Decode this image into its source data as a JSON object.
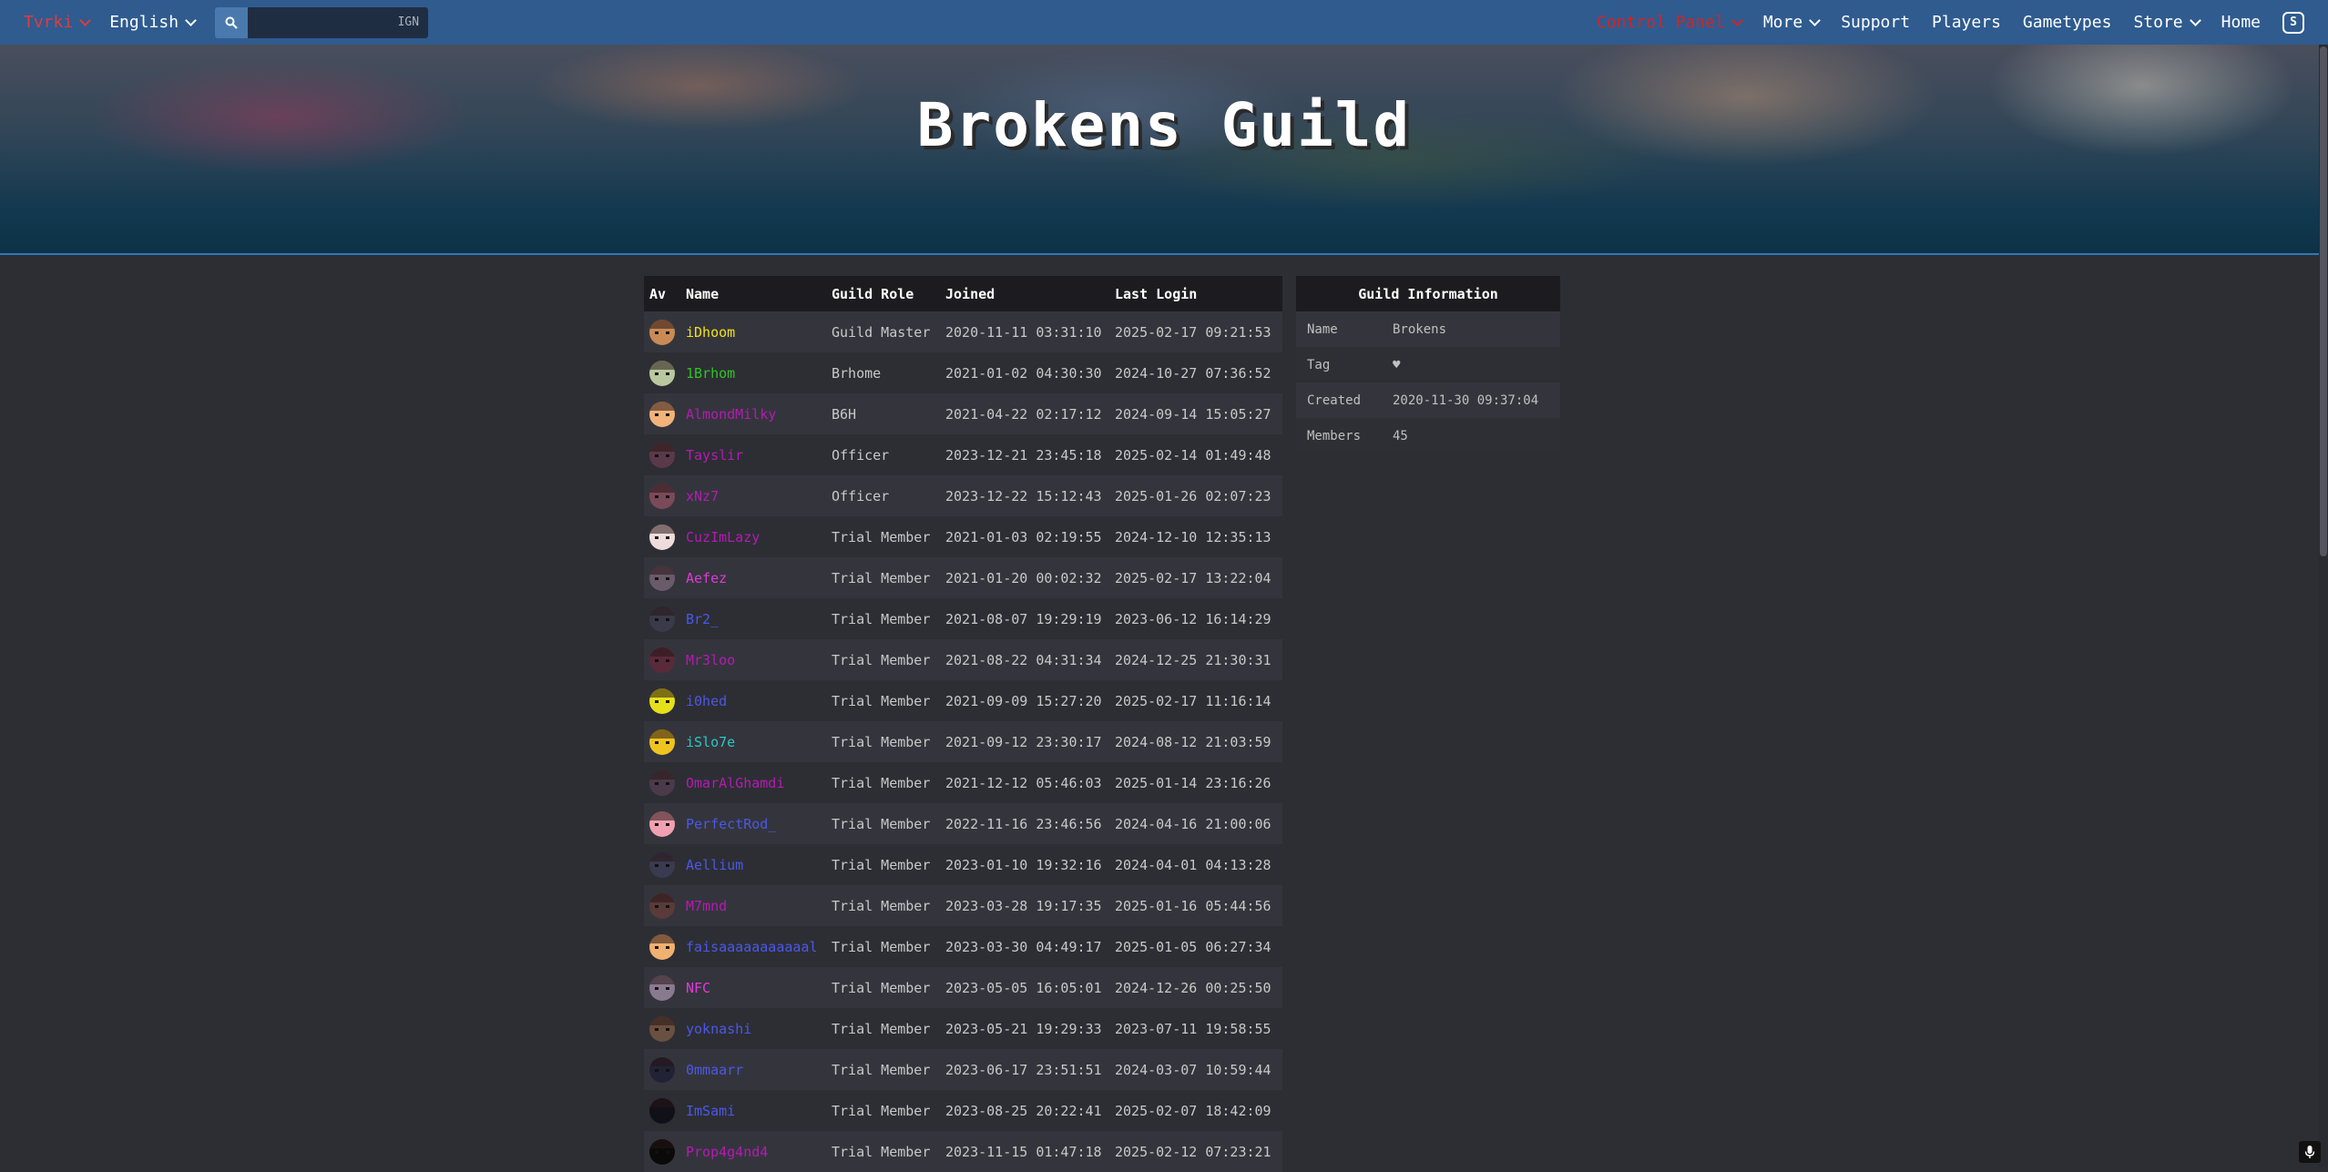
{
  "nav": {
    "user": "Tvrki",
    "language": "English",
    "search_placeholder": "IGN",
    "control_panel": "Control Panel",
    "more": "More",
    "support": "Support",
    "players": "Players",
    "gametypes": "Gametypes",
    "store": "Store",
    "home": "Home",
    "logo_letter": "S"
  },
  "banner": {
    "title": "Brokens Guild"
  },
  "members_table": {
    "headers": {
      "av": "Av",
      "name": "Name",
      "role": "Guild Role",
      "joined": "Joined",
      "last_login": "Last Login"
    },
    "rows": [
      {
        "name": "iDhoom",
        "name_color": "#f0e21a",
        "role": "Guild Master",
        "joined": "2020-11-11 03:31:10",
        "last_login": "2025-02-17 09:21:53",
        "avatar_color": "#c98b55"
      },
      {
        "name": "1Brhom",
        "name_color": "#2ec425",
        "role": "Brhome",
        "joined": "2021-01-02 04:30:30",
        "last_login": "2024-10-27 07:36:52",
        "avatar_color": "#b8c7a0"
      },
      {
        "name": "AlmondMilky",
        "name_color": "#b51ab5",
        "role": "B6H",
        "joined": "2021-04-22 02:17:12",
        "last_login": "2024-09-14 15:05:27",
        "avatar_color": "#f2b27a"
      },
      {
        "name": "Tayslir",
        "name_color": "#b51ab5",
        "role": "Officer",
        "joined": "2023-12-21 23:45:18",
        "last_login": "2025-02-14 01:49:48",
        "avatar_color": "#5a3a4a"
      },
      {
        "name": "xNz7",
        "name_color": "#b51ab5",
        "role": "Officer",
        "joined": "2023-12-22 15:12:43",
        "last_login": "2025-01-26 02:07:23",
        "avatar_color": "#7a4a5a"
      },
      {
        "name": "CuzImLazy",
        "name_color": "#b51ab5",
        "role": "Trial Member",
        "joined": "2021-01-03 02:19:55",
        "last_login": "2024-12-10 12:35:13",
        "avatar_color": "#eedcdc"
      },
      {
        "name": "Aefez",
        "name_color": "#e03ad9",
        "role": "Trial Member",
        "joined": "2021-01-20 00:02:32",
        "last_login": "2025-02-17 13:22:04",
        "avatar_color": "#6a5a6a"
      },
      {
        "name": "Br2_",
        "name_color": "#4a58e8",
        "role": "Trial Member",
        "joined": "2021-08-07 19:29:19",
        "last_login": "2023-06-12 16:14:29",
        "avatar_color": "#3a3a4a"
      },
      {
        "name": "Mr3loo",
        "name_color": "#b51ab5",
        "role": "Trial Member",
        "joined": "2021-08-22 04:31:34",
        "last_login": "2024-12-25 21:30:31",
        "avatar_color": "#5a2a3a"
      },
      {
        "name": "i0hed",
        "name_color": "#4a58e8",
        "role": "Trial Member",
        "joined": "2021-09-09 15:27:20",
        "last_login": "2025-02-17 11:16:14",
        "avatar_color": "#e6e01a"
      },
      {
        "name": "iSlo7e",
        "name_color": "#2cc7c7",
        "role": "Trial Member",
        "joined": "2021-09-12 23:30:17",
        "last_login": "2024-08-12 21:03:59",
        "avatar_color": "#f0c420"
      },
      {
        "name": "OmarAlGhamdi",
        "name_color": "#b51ab5",
        "role": "Trial Member",
        "joined": "2021-12-12 05:46:03",
        "last_login": "2025-01-14 23:16:26",
        "avatar_color": "#4a3a4a"
      },
      {
        "name": "PerfectRod_",
        "name_color": "#4a58e8",
        "role": "Trial Member",
        "joined": "2022-11-16 23:46:56",
        "last_login": "2024-04-16 21:00:06",
        "avatar_color": "#f0a0b0"
      },
      {
        "name": "Aellium",
        "name_color": "#4a58e8",
        "role": "Trial Member",
        "joined": "2023-01-10 19:32:16",
        "last_login": "2024-04-01 04:13:28",
        "avatar_color": "#3a3a50"
      },
      {
        "name": "M7mnd",
        "name_color": "#b51ab5",
        "role": "Trial Member",
        "joined": "2023-03-28 19:17:35",
        "last_login": "2025-01-16 05:44:56",
        "avatar_color": "#5a3a3a"
      },
      {
        "name": "faisaaaaaaaaaaal",
        "name_color": "#4a58e8",
        "role": "Trial Member",
        "joined": "2023-03-30 04:49:17",
        "last_login": "2025-01-05 06:27:34",
        "avatar_color": "#f0b070"
      },
      {
        "name": "NFC",
        "name_color": "#e03ad9",
        "role": "Trial Member",
        "joined": "2023-05-05 16:05:01",
        "last_login": "2024-12-26 00:25:50",
        "avatar_color": "#8a7a90"
      },
      {
        "name": "yoknashi",
        "name_color": "#4a58e8",
        "role": "Trial Member",
        "joined": "2023-05-21 19:29:33",
        "last_login": "2023-07-11 19:58:55",
        "avatar_color": "#6a5040"
      },
      {
        "name": "0mmaarr",
        "name_color": "#4a58e8",
        "role": "Trial Member",
        "joined": "2023-06-17 23:51:51",
        "last_login": "2024-03-07 10:59:44",
        "avatar_color": "#222236"
      },
      {
        "name": "ImSami",
        "name_color": "#4a58e8",
        "role": "Trial Member",
        "joined": "2023-08-25 20:22:41",
        "last_login": "2025-02-07 18:42:09",
        "avatar_color": "#101018"
      },
      {
        "name": "Prop4g4nd4",
        "name_color": "#b51ab5",
        "role": "Trial Member",
        "joined": "2023-11-15 01:47:18",
        "last_login": "2025-02-12 07:23:21",
        "avatar_color": "#0a0a0a"
      }
    ]
  },
  "guild_info": {
    "heading": "Guild Information",
    "rows": [
      {
        "key": "Name",
        "value": "Brokens"
      },
      {
        "key": "Tag",
        "value": "♥"
      },
      {
        "key": "Created",
        "value": "2020-11-30 09:37:04"
      },
      {
        "key": "Members",
        "value": "45"
      }
    ]
  },
  "colors": {
    "nav_bg": "#2f5b8f",
    "page_bg": "#2d2e33",
    "accent_red": "#d42424"
  }
}
